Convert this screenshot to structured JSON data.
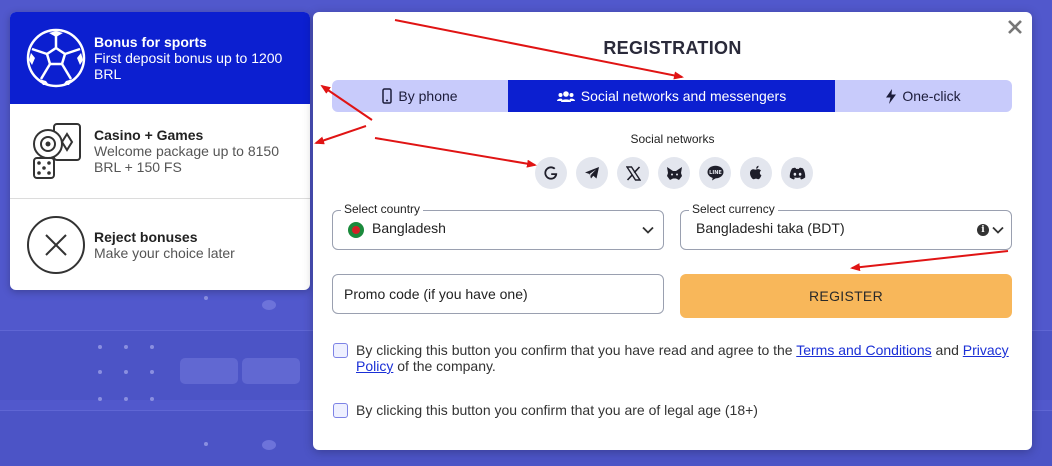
{
  "bonus": {
    "items": [
      {
        "title": "Bonus for sports",
        "desc": "First deposit bonus up to 1200 BRL",
        "icon": "soccer-ball-icon",
        "active": true
      },
      {
        "title": "Casino + Games",
        "desc": "Welcome package up to 8150 BRL + 150 FS",
        "icon": "casino-cards-dice-icon",
        "active": false
      },
      {
        "title": "Reject bonuses",
        "desc": "Make your choice later",
        "icon": "close-circle-icon",
        "active": false
      }
    ]
  },
  "modal": {
    "title": "REGISTRATION",
    "close_icon": "close-icon",
    "tabs": [
      {
        "label": "By phone",
        "icon": "phone-icon",
        "active": false
      },
      {
        "label": "Social networks and messengers",
        "icon": "users-icon",
        "active": true
      },
      {
        "label": "One-click",
        "icon": "lightning-icon",
        "active": false
      }
    ],
    "social_label": "Social networks",
    "social_icons": [
      "google-icon",
      "telegram-icon",
      "x-icon",
      "metamask-icon",
      "line-icon",
      "apple-icon",
      "discord-icon"
    ],
    "country": {
      "label": "Select country",
      "value": "Bangladesh"
    },
    "currency": {
      "label": "Select currency",
      "value": "Bangladeshi taka (BDT)"
    },
    "promo": {
      "placeholder": "Promo code (if you have one)"
    },
    "register_label": "REGISTER",
    "terms": {
      "prefix": "By clicking this button you confirm that you have read and agree to the",
      "terms_link": "Terms and Conditions",
      "and": "and",
      "privacy_link_1": "Privacy",
      "privacy_link_2": "Policy",
      "suffix": "of the company."
    },
    "age_text": "By clicking this button you confirm that you are of legal age (18+)"
  },
  "colors": {
    "accent": "#0c1fd0",
    "tab_bg": "#c8cbfb",
    "register": "#f8b75a",
    "backdrop": "#5158cc",
    "arrow": "#e01414"
  }
}
